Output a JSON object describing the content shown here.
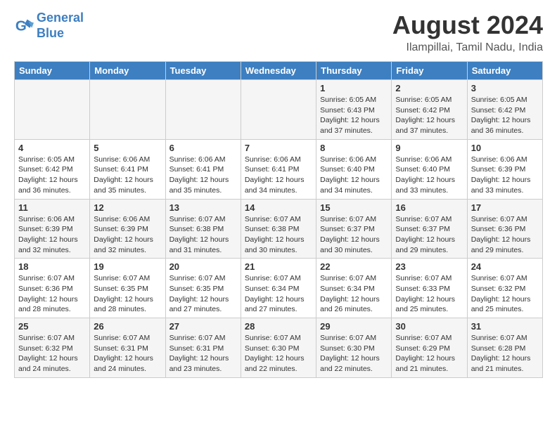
{
  "header": {
    "logo_line1": "General",
    "logo_line2": "Blue",
    "month_title": "August 2024",
    "location": "Ilampillai, Tamil Nadu, India"
  },
  "weekdays": [
    "Sunday",
    "Monday",
    "Tuesday",
    "Wednesday",
    "Thursday",
    "Friday",
    "Saturday"
  ],
  "weeks": [
    [
      {
        "day": "",
        "info": ""
      },
      {
        "day": "",
        "info": ""
      },
      {
        "day": "",
        "info": ""
      },
      {
        "day": "",
        "info": ""
      },
      {
        "day": "1",
        "info": "Sunrise: 6:05 AM\nSunset: 6:43 PM\nDaylight: 12 hours\nand 37 minutes."
      },
      {
        "day": "2",
        "info": "Sunrise: 6:05 AM\nSunset: 6:42 PM\nDaylight: 12 hours\nand 37 minutes."
      },
      {
        "day": "3",
        "info": "Sunrise: 6:05 AM\nSunset: 6:42 PM\nDaylight: 12 hours\nand 36 minutes."
      }
    ],
    [
      {
        "day": "4",
        "info": "Sunrise: 6:05 AM\nSunset: 6:42 PM\nDaylight: 12 hours\nand 36 minutes."
      },
      {
        "day": "5",
        "info": "Sunrise: 6:06 AM\nSunset: 6:41 PM\nDaylight: 12 hours\nand 35 minutes."
      },
      {
        "day": "6",
        "info": "Sunrise: 6:06 AM\nSunset: 6:41 PM\nDaylight: 12 hours\nand 35 minutes."
      },
      {
        "day": "7",
        "info": "Sunrise: 6:06 AM\nSunset: 6:41 PM\nDaylight: 12 hours\nand 34 minutes."
      },
      {
        "day": "8",
        "info": "Sunrise: 6:06 AM\nSunset: 6:40 PM\nDaylight: 12 hours\nand 34 minutes."
      },
      {
        "day": "9",
        "info": "Sunrise: 6:06 AM\nSunset: 6:40 PM\nDaylight: 12 hours\nand 33 minutes."
      },
      {
        "day": "10",
        "info": "Sunrise: 6:06 AM\nSunset: 6:39 PM\nDaylight: 12 hours\nand 33 minutes."
      }
    ],
    [
      {
        "day": "11",
        "info": "Sunrise: 6:06 AM\nSunset: 6:39 PM\nDaylight: 12 hours\nand 32 minutes."
      },
      {
        "day": "12",
        "info": "Sunrise: 6:06 AM\nSunset: 6:39 PM\nDaylight: 12 hours\nand 32 minutes."
      },
      {
        "day": "13",
        "info": "Sunrise: 6:07 AM\nSunset: 6:38 PM\nDaylight: 12 hours\nand 31 minutes."
      },
      {
        "day": "14",
        "info": "Sunrise: 6:07 AM\nSunset: 6:38 PM\nDaylight: 12 hours\nand 30 minutes."
      },
      {
        "day": "15",
        "info": "Sunrise: 6:07 AM\nSunset: 6:37 PM\nDaylight: 12 hours\nand 30 minutes."
      },
      {
        "day": "16",
        "info": "Sunrise: 6:07 AM\nSunset: 6:37 PM\nDaylight: 12 hours\nand 29 minutes."
      },
      {
        "day": "17",
        "info": "Sunrise: 6:07 AM\nSunset: 6:36 PM\nDaylight: 12 hours\nand 29 minutes."
      }
    ],
    [
      {
        "day": "18",
        "info": "Sunrise: 6:07 AM\nSunset: 6:36 PM\nDaylight: 12 hours\nand 28 minutes."
      },
      {
        "day": "19",
        "info": "Sunrise: 6:07 AM\nSunset: 6:35 PM\nDaylight: 12 hours\nand 28 minutes."
      },
      {
        "day": "20",
        "info": "Sunrise: 6:07 AM\nSunset: 6:35 PM\nDaylight: 12 hours\nand 27 minutes."
      },
      {
        "day": "21",
        "info": "Sunrise: 6:07 AM\nSunset: 6:34 PM\nDaylight: 12 hours\nand 27 minutes."
      },
      {
        "day": "22",
        "info": "Sunrise: 6:07 AM\nSunset: 6:34 PM\nDaylight: 12 hours\nand 26 minutes."
      },
      {
        "day": "23",
        "info": "Sunrise: 6:07 AM\nSunset: 6:33 PM\nDaylight: 12 hours\nand 25 minutes."
      },
      {
        "day": "24",
        "info": "Sunrise: 6:07 AM\nSunset: 6:32 PM\nDaylight: 12 hours\nand 25 minutes."
      }
    ],
    [
      {
        "day": "25",
        "info": "Sunrise: 6:07 AM\nSunset: 6:32 PM\nDaylight: 12 hours\nand 24 minutes."
      },
      {
        "day": "26",
        "info": "Sunrise: 6:07 AM\nSunset: 6:31 PM\nDaylight: 12 hours\nand 24 minutes."
      },
      {
        "day": "27",
        "info": "Sunrise: 6:07 AM\nSunset: 6:31 PM\nDaylight: 12 hours\nand 23 minutes."
      },
      {
        "day": "28",
        "info": "Sunrise: 6:07 AM\nSunset: 6:30 PM\nDaylight: 12 hours\nand 22 minutes."
      },
      {
        "day": "29",
        "info": "Sunrise: 6:07 AM\nSunset: 6:30 PM\nDaylight: 12 hours\nand 22 minutes."
      },
      {
        "day": "30",
        "info": "Sunrise: 6:07 AM\nSunset: 6:29 PM\nDaylight: 12 hours\nand 21 minutes."
      },
      {
        "day": "31",
        "info": "Sunrise: 6:07 AM\nSunset: 6:28 PM\nDaylight: 12 hours\nand 21 minutes."
      }
    ]
  ]
}
